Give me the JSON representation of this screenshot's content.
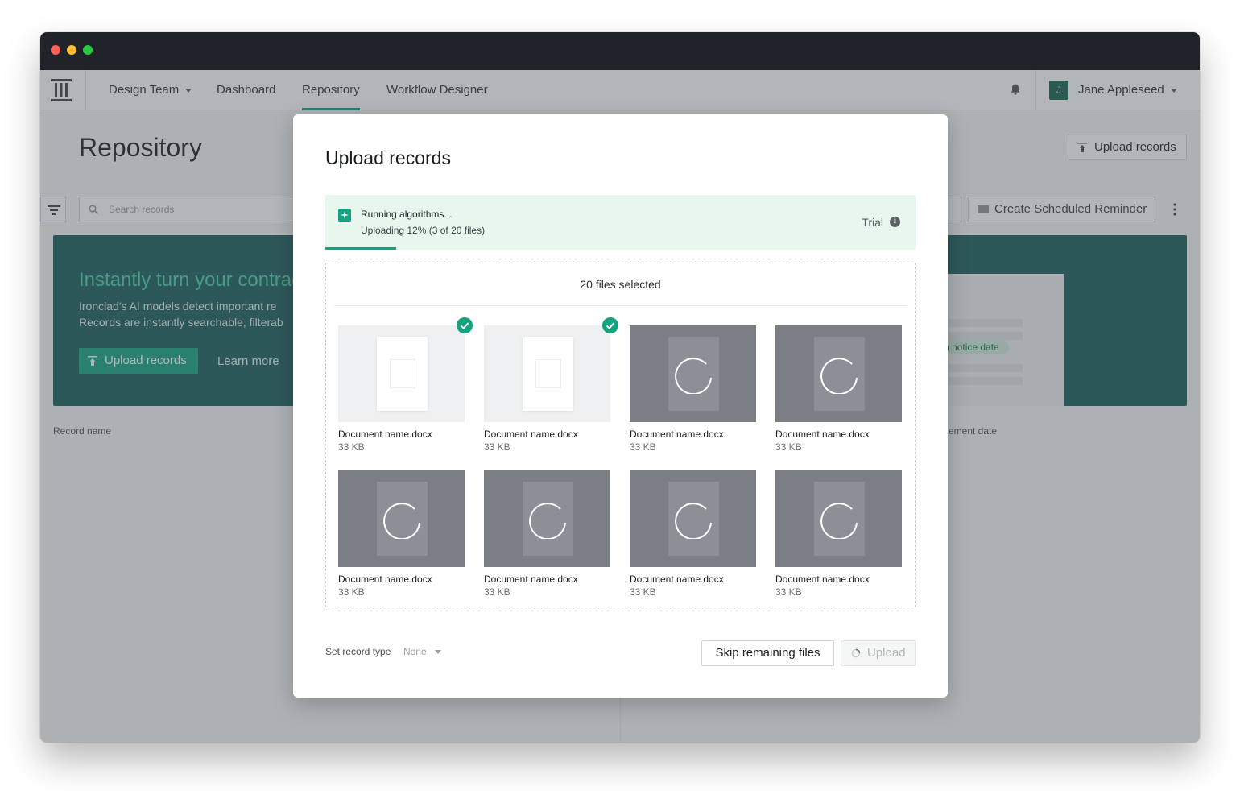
{
  "nav": {
    "workspace": "Design Team",
    "items": [
      "Dashboard",
      "Repository",
      "Workflow Designer"
    ],
    "active": "Repository",
    "user_initial": "J",
    "user_name": "Jane Appleseed"
  },
  "page": {
    "title": "Repository",
    "upload_button": "Upload records",
    "search_placeholder": "Search records",
    "reminder_button": "Create Scheduled Reminder"
  },
  "banner": {
    "title": "Instantly turn your contrac",
    "line1": "Ironclad's AI models detect important re",
    "line2": "Records are instantly searchable, filterab",
    "upload_button": "Upload records",
    "learn_more": "Learn more",
    "pill_text": "n notice date"
  },
  "table": {
    "columns": [
      "Record name",
      "ement date"
    ]
  },
  "modal": {
    "title": "Upload records",
    "status_title": "Running algorithms...",
    "status_sub": "Uploading 12% (3 of 20 files)",
    "progress": 0.12,
    "trial_label": "Trial",
    "files_selected": "20 files selected",
    "files": [
      {
        "name": "Document name.docx",
        "size": "33 KB",
        "status": "done"
      },
      {
        "name": "Document name.docx",
        "size": "33 KB",
        "status": "done"
      },
      {
        "name": "Document name.docx",
        "size": "33 KB",
        "status": "loading"
      },
      {
        "name": "Document name.docx",
        "size": "33 KB",
        "status": "loading"
      },
      {
        "name": "Document name.docx",
        "size": "33 KB",
        "status": "loading"
      },
      {
        "name": "Document name.docx",
        "size": "33 KB",
        "status": "loading"
      },
      {
        "name": "Document name.docx",
        "size": "33 KB",
        "status": "loading"
      },
      {
        "name": "Document name.docx",
        "size": "33 KB",
        "status": "loading"
      }
    ],
    "record_type_label": "Set record type",
    "record_type_value": "None",
    "skip_button": "Skip remaining files",
    "upload_button": "Upload"
  },
  "colors": {
    "accent": "#14a37f",
    "banner_bg": "#195e5c",
    "titlebar": "#20232a",
    "traffic_red": "#fe5f57",
    "traffic_yellow": "#febc2e",
    "traffic_green": "#28c840"
  }
}
